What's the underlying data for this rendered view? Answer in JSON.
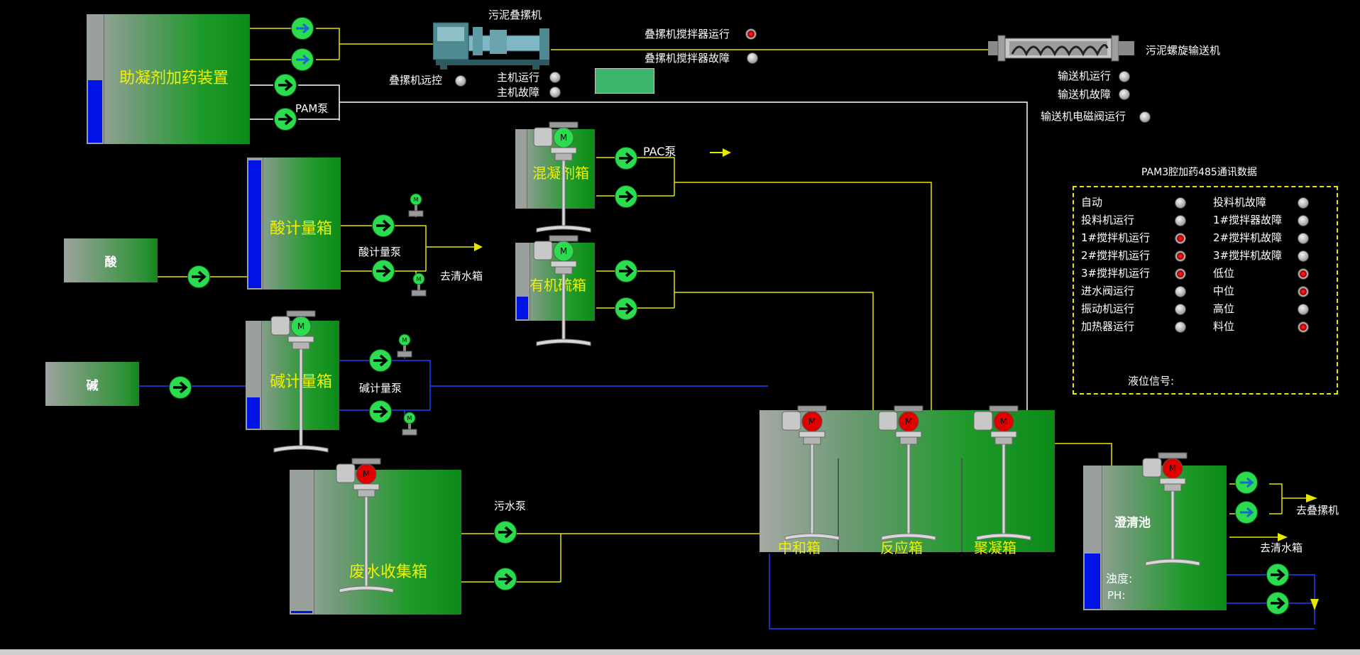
{
  "tanks": {
    "coagulant_dosing": "助凝剂加药装置",
    "acid_metering": "酸计量箱",
    "alkali_metering": "碱计量箱",
    "wastewater_collection": "废水收集箱",
    "coagulant_box": "混凝剂箱",
    "organic_sulfur": "有机硫箱",
    "neutralization": "中和箱",
    "reaction": "反应箱",
    "flocculation": "聚凝箱",
    "clarifier": "澄清池"
  },
  "sources": {
    "acid": "酸",
    "alkali": "碱"
  },
  "labels": {
    "sludge_stacker": "污泥叠摞机",
    "screw_conveyor": "污泥螺旋输送机",
    "pam_pump": "PAM泵",
    "pac_pump": "PAC泵",
    "acid_pump": "酸计量泵",
    "alkali_pump": "碱计量泵",
    "to_clear_water_1": "去清水箱",
    "sewage_pump": "污水泵",
    "to_stacker": "去叠摞机",
    "to_clear_water_2": "去清水箱",
    "turbidity": "浊度:",
    "ph": "PH:"
  },
  "status": {
    "stacker_mixer_running": "叠摞机搅拌器运行",
    "stacker_mixer_fault": "叠摞机搅拌器故障",
    "stacker_remote": "叠摞机远控",
    "main_running": "主机运行",
    "main_fault": "主机故障",
    "conveyor_running": "输送机运行",
    "conveyor_fault": "输送机故障",
    "conveyor_valve_running": "输送机电磁阀运行"
  },
  "panel": {
    "title": "PAM3腔加药485通讯数据",
    "left": [
      {
        "label": "自动",
        "state": "off"
      },
      {
        "label": "投料机运行",
        "state": "off"
      },
      {
        "label": "1#搅拌机运行",
        "state": "on"
      },
      {
        "label": "2#搅拌机运行",
        "state": "on"
      },
      {
        "label": "3#搅拌机运行",
        "state": "on"
      },
      {
        "label": "进水阀运行",
        "state": "off"
      },
      {
        "label": "振动机运行",
        "state": "off"
      },
      {
        "label": "加热器运行",
        "state": "off"
      }
    ],
    "right": [
      {
        "label": "投料机故障",
        "state": "off"
      },
      {
        "label": "1#搅拌器故障",
        "state": "off"
      },
      {
        "label": "2#搅拌机故障",
        "state": "off"
      },
      {
        "label": "3#搅拌机故障",
        "state": "off"
      },
      {
        "label": "低位",
        "state": "on"
      },
      {
        "label": "中位",
        "state": "on"
      },
      {
        "label": "高位",
        "state": "off"
      },
      {
        "label": "料位",
        "state": "on"
      }
    ],
    "level_signal": "液位信号:"
  },
  "motor_letter": "M",
  "colors": {
    "background": "#000000",
    "pipe_yellow": "#e6e600",
    "pipe_white": "#ffffff",
    "pipe_blue": "#2040ff",
    "tank_green": "#1f9a2a",
    "level_blue": "#0014e8",
    "pump_green": "#2bdc4f",
    "motor_red": "#e00000",
    "label_yellow": "#f0f000"
  }
}
